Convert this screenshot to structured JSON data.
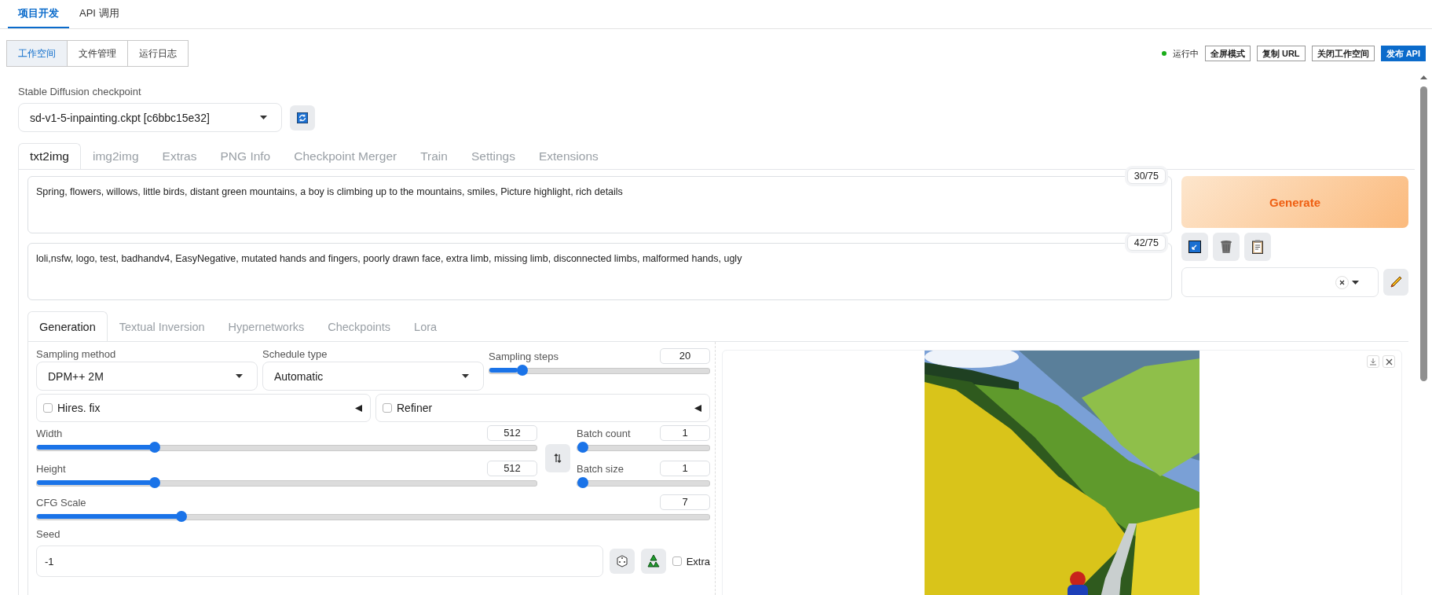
{
  "top_tabs": [
    {
      "label": "项目开发",
      "selected": true
    },
    {
      "label": "API 调用",
      "selected": false
    }
  ],
  "workspace_tabs": [
    {
      "label": "工作空间",
      "selected": true
    },
    {
      "label": "文件管理",
      "selected": false
    },
    {
      "label": "运行日志",
      "selected": false
    }
  ],
  "status": "运行中",
  "actions": [
    {
      "label": "全屏模式",
      "kind": "default"
    },
    {
      "label": "复制 URL",
      "kind": "default"
    },
    {
      "label": "关闭工作空间",
      "kind": "default"
    },
    {
      "label": "发布 API",
      "kind": "primary"
    }
  ],
  "checkpoint": {
    "label": "Stable Diffusion checkpoint",
    "value": "sd-v1-5-inpainting.ckpt [c6bbc15e32]"
  },
  "main_tabs": [
    {
      "label": "txt2img",
      "selected": true
    },
    {
      "label": "img2img",
      "selected": false
    },
    {
      "label": "Extras",
      "selected": false
    },
    {
      "label": "PNG Info",
      "selected": false
    },
    {
      "label": "Checkpoint Merger",
      "selected": false
    },
    {
      "label": "Train",
      "selected": false
    },
    {
      "label": "Settings",
      "selected": false
    },
    {
      "label": "Extensions",
      "selected": false
    }
  ],
  "prompt": {
    "value": "Spring, flowers, willows, little birds, distant green mountains, a boy is climbing up to the mountains, smiles, Picture highlight, rich details",
    "counter": "30/75"
  },
  "negative_prompt": {
    "value": "loli,nsfw, logo, test, badhandv4, EasyNegative, mutated hands and fingers, poorly drawn face, extra limb, missing limb, disconnected limbs, malformed hands, ugly",
    "counter": "42/75"
  },
  "generate_button": "Generate",
  "sub_tabs": [
    {
      "label": "Generation",
      "selected": true
    },
    {
      "label": "Textual Inversion",
      "selected": false
    },
    {
      "label": "Hypernetworks",
      "selected": false
    },
    {
      "label": "Checkpoints",
      "selected": false
    },
    {
      "label": "Lora",
      "selected": false
    }
  ],
  "sampling_method": {
    "label": "Sampling method",
    "value": "DPM++ 2M"
  },
  "schedule_type": {
    "label": "Schedule type",
    "value": "Automatic"
  },
  "sampling_steps": {
    "label": "Sampling steps",
    "value": "20",
    "level": 0.13
  },
  "accordions": [
    {
      "label": "Hires. fix",
      "checked": false
    },
    {
      "label": "Refiner",
      "checked": false
    }
  ],
  "width": {
    "label": "Width",
    "value": "512",
    "level": 0.23
  },
  "height": {
    "label": "Height",
    "value": "512",
    "level": 0.23
  },
  "batch_count": {
    "label": "Batch count",
    "value": "1",
    "level": 0
  },
  "batch_size": {
    "label": "Batch size",
    "value": "1",
    "level": 0
  },
  "cfg_scale": {
    "label": "CFG Scale",
    "value": "7",
    "level": 0.21
  },
  "seed": {
    "label": "Seed",
    "value": "-1"
  },
  "extra": {
    "label": "Extra",
    "checked": false
  }
}
